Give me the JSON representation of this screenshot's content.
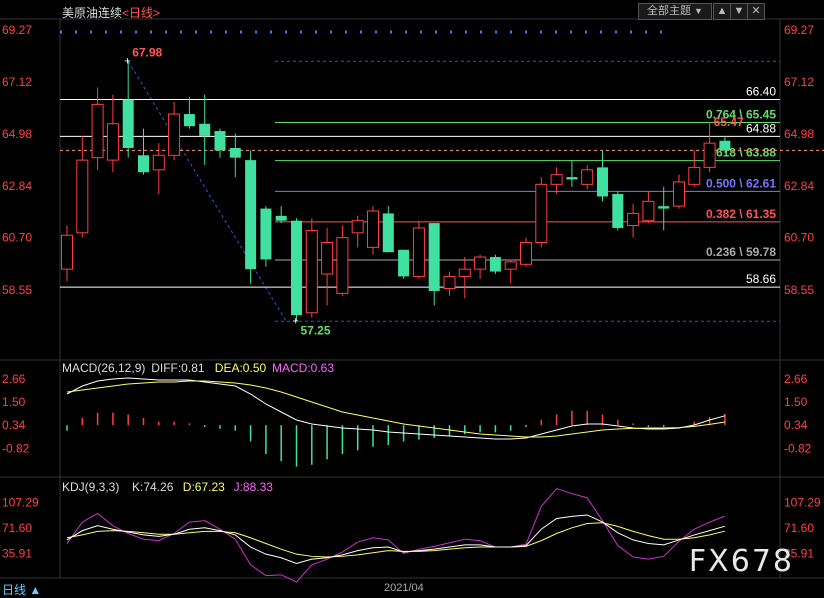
{
  "header": {
    "symbol": "美原油连续",
    "period": "<日线>",
    "theme_label": "全部主题",
    "theme_arrow": "▼",
    "nav_up": "▲",
    "nav_down": "▼",
    "nav_close": "✕"
  },
  "footer": {
    "period_label": "日线 ▲",
    "date_label": "2021/04"
  },
  "watermark": "FX678",
  "colors": {
    "up": "#ff4040",
    "down": "#40e0a0",
    "bg": "#000000",
    "grid": "#333333",
    "fib": "#ff5050",
    "macd_dif": "#ffffff",
    "macd_dea": "#ffff66",
    "kdj_j": "#cc33cc"
  },
  "chart_data": [
    {
      "type": "candlestick",
      "title": "美原油连续",
      "y_ticks": [
        69.27,
        67.12,
        64.98,
        62.84,
        60.7,
        58.55
      ],
      "ylim": [
        56.6,
        69.6
      ],
      "candles": [
        {
          "o": 59.4,
          "h": 61.2,
          "l": 58.9,
          "c": 60.8
        },
        {
          "o": 60.9,
          "h": 64.9,
          "l": 60.7,
          "c": 63.9
        },
        {
          "o": 64.0,
          "h": 66.9,
          "l": 63.5,
          "c": 66.2
        },
        {
          "o": 63.9,
          "h": 66.6,
          "l": 63.4,
          "c": 65.4
        },
        {
          "o": 66.4,
          "h": 67.98,
          "l": 64.0,
          "c": 64.4
        },
        {
          "o": 64.1,
          "h": 65.2,
          "l": 63.3,
          "c": 63.4
        },
        {
          "o": 63.5,
          "h": 64.6,
          "l": 62.5,
          "c": 64.1
        },
        {
          "o": 64.1,
          "h": 66.3,
          "l": 63.9,
          "c": 65.8
        },
        {
          "o": 65.8,
          "h": 66.5,
          "l": 65.2,
          "c": 65.3
        },
        {
          "o": 65.4,
          "h": 66.6,
          "l": 63.7,
          "c": 64.9
        },
        {
          "o": 65.1,
          "h": 65.2,
          "l": 64.0,
          "c": 64.3
        },
        {
          "o": 64.4,
          "h": 65.0,
          "l": 63.2,
          "c": 64.0
        },
        {
          "o": 63.9,
          "h": 64.3,
          "l": 58.8,
          "c": 59.4
        },
        {
          "o": 61.9,
          "h": 62.0,
          "l": 59.5,
          "c": 59.8
        },
        {
          "o": 61.6,
          "h": 62.0,
          "l": 61.3,
          "c": 61.4
        },
        {
          "o": 61.4,
          "h": 61.5,
          "l": 57.25,
          "c": 57.5
        },
        {
          "o": 57.6,
          "h": 61.5,
          "l": 57.4,
          "c": 61.0
        },
        {
          "o": 59.2,
          "h": 61.1,
          "l": 57.9,
          "c": 60.5
        },
        {
          "o": 58.4,
          "h": 61.2,
          "l": 58.3,
          "c": 60.7
        },
        {
          "o": 60.9,
          "h": 61.6,
          "l": 60.3,
          "c": 61.4
        },
        {
          "o": 60.3,
          "h": 62.0,
          "l": 60.0,
          "c": 61.8
        },
        {
          "o": 61.7,
          "h": 62.0,
          "l": 61.6,
          "c": 60.1
        },
        {
          "o": 60.2,
          "h": 60.2,
          "l": 59.0,
          "c": 59.1
        },
        {
          "o": 59.1,
          "h": 61.4,
          "l": 59.0,
          "c": 61.1
        },
        {
          "o": 61.3,
          "h": 61.3,
          "l": 57.9,
          "c": 58.5
        },
        {
          "o": 58.6,
          "h": 59.3,
          "l": 58.3,
          "c": 59.1
        },
        {
          "o": 59.1,
          "h": 59.9,
          "l": 58.2,
          "c": 59.4
        },
        {
          "o": 59.4,
          "h": 60.0,
          "l": 59.0,
          "c": 59.9
        },
        {
          "o": 59.9,
          "h": 60.0,
          "l": 59.2,
          "c": 59.3
        },
        {
          "o": 59.4,
          "h": 59.8,
          "l": 58.8,
          "c": 59.7
        },
        {
          "o": 59.6,
          "h": 60.7,
          "l": 59.5,
          "c": 60.5
        },
        {
          "o": 60.5,
          "h": 63.2,
          "l": 60.3,
          "c": 62.9
        },
        {
          "o": 62.9,
          "h": 63.6,
          "l": 62.5,
          "c": 63.3
        },
        {
          "o": 63.2,
          "h": 63.9,
          "l": 62.8,
          "c": 63.1
        },
        {
          "o": 62.9,
          "h": 63.7,
          "l": 62.7,
          "c": 63.5
        },
        {
          "o": 63.6,
          "h": 64.3,
          "l": 62.2,
          "c": 62.4
        },
        {
          "o": 62.5,
          "h": 62.6,
          "l": 61.0,
          "c": 61.1
        },
        {
          "o": 61.2,
          "h": 62.1,
          "l": 60.7,
          "c": 61.7
        },
        {
          "o": 61.4,
          "h": 62.6,
          "l": 61.3,
          "c": 62.2
        },
        {
          "o": 62.0,
          "h": 62.8,
          "l": 61.0,
          "c": 61.9
        },
        {
          "o": 62.0,
          "h": 63.3,
          "l": 61.9,
          "c": 63.0
        },
        {
          "o": 62.9,
          "h": 64.3,
          "l": 62.8,
          "c": 63.6
        },
        {
          "o": 63.6,
          "h": 65.47,
          "l": 63.4,
          "c": 64.6
        },
        {
          "o": 64.7,
          "h": 64.9,
          "l": 64.2,
          "c": 64.3
        }
      ],
      "h_lines": [
        {
          "value": 66.4,
          "label": "66.40",
          "color": "#ffffff"
        },
        {
          "value": 64.88,
          "label": "64.88",
          "color": "#ffffff"
        },
        {
          "value": 58.66,
          "label": "58.66",
          "color": "#ffffff"
        }
      ],
      "fib_levels": [
        {
          "value": 65.45,
          "label": "0.764 \\ 65.45",
          "color": "#66dd66"
        },
        {
          "value": 63.88,
          "label": "0.618 \\ 63.88",
          "color": "#66dd66"
        },
        {
          "value": 62.61,
          "label": "0.500 \\ 62.61",
          "color": "#7777ff"
        },
        {
          "value": 61.35,
          "label": "0.382 \\ 61.35",
          "color": "#ff5555"
        },
        {
          "value": 59.78,
          "label": "0.236 \\ 59.78",
          "color": "#aaaaaa"
        }
      ],
      "fib_high": 67.98,
      "fib_low": 57.25,
      "current_price": 64.3,
      "annotations": [
        {
          "text": "67.98",
          "value": 67.98,
          "candle": 4,
          "color": "#ff5555",
          "pos": "above"
        },
        {
          "text": "57.25",
          "value": 57.25,
          "candle": 15,
          "color": "#66dd66",
          "pos": "below"
        },
        {
          "text": "65.47",
          "value": 65.47,
          "candle": 42,
          "color": "#ff5555",
          "pos": "left"
        }
      ]
    },
    {
      "type": "macd",
      "title": "MACD(26,12,9)",
      "legend": [
        {
          "text": "MACD(26,12,9)",
          "color": "#dddddd"
        },
        {
          "text": "DIFF:0.81",
          "color": "#dddddd"
        },
        {
          "text": "DEA:0.50",
          "color": "#ffff66"
        },
        {
          "text": "MACD:0.63",
          "color": "#ff66ff"
        }
      ],
      "y_ticks": [
        2.66,
        1.5,
        0.34,
        -0.82
      ],
      "ylim": [
        -1.8,
        3.0
      ],
      "dif": [
        1.9,
        2.3,
        2.55,
        2.65,
        2.7,
        2.65,
        2.6,
        2.6,
        2.6,
        2.5,
        2.4,
        2.3,
        1.9,
        1.4,
        1.0,
        0.6,
        0.4,
        0.3,
        0.2,
        0.15,
        0.1,
        0.0,
        -0.05,
        -0.1,
        -0.15,
        -0.2,
        -0.25,
        -0.3,
        -0.35,
        -0.35,
        -0.3,
        -0.1,
        0.1,
        0.3,
        0.4,
        0.4,
        0.3,
        0.2,
        0.15,
        0.15,
        0.2,
        0.35,
        0.6,
        0.81
      ],
      "dea": [
        2.0,
        2.1,
        2.2,
        2.3,
        2.4,
        2.45,
        2.5,
        2.5,
        2.55,
        2.55,
        2.5,
        2.45,
        2.35,
        2.2,
        2.0,
        1.75,
        1.5,
        1.25,
        1.0,
        0.85,
        0.7,
        0.55,
        0.4,
        0.3,
        0.2,
        0.1,
        0.0,
        -0.1,
        -0.15,
        -0.2,
        -0.25,
        -0.25,
        -0.2,
        -0.1,
        0.0,
        0.1,
        0.15,
        0.18,
        0.2,
        0.2,
        0.22,
        0.28,
        0.38,
        0.5
      ],
      "hist": [
        -0.3,
        0.4,
        0.7,
        0.7,
        0.6,
        0.4,
        0.2,
        0.2,
        0.1,
        -0.1,
        -0.2,
        -0.3,
        -0.9,
        -1.6,
        -2.0,
        -2.3,
        -2.2,
        -1.9,
        -1.6,
        -1.4,
        -1.2,
        -1.1,
        -0.9,
        -0.8,
        -0.7,
        -0.6,
        -0.5,
        -0.4,
        -0.4,
        -0.3,
        -0.1,
        0.3,
        0.6,
        0.8,
        0.8,
        0.6,
        0.3,
        0.1,
        -0.1,
        -0.1,
        0.0,
        0.2,
        0.45,
        0.63
      ]
    },
    {
      "type": "kdj",
      "title": "KDJ(9,3,3)",
      "legend": [
        {
          "text": "KDJ(9,3,3)",
          "color": "#dddddd"
        },
        {
          "text": "K:74.26",
          "color": "#dddddd"
        },
        {
          "text": "D:67.23",
          "color": "#ffff66"
        },
        {
          "text": "J:88.33",
          "color": "#ff66ff"
        }
      ],
      "y_ticks": [
        107.29,
        71.6,
        35.91
      ],
      "ylim": [
        10,
        125
      ],
      "k": [
        55,
        68,
        75,
        70,
        66,
        62,
        60,
        63,
        70,
        72,
        68,
        62,
        45,
        35,
        30,
        22,
        28,
        30,
        34,
        40,
        44,
        45,
        38,
        40,
        42,
        45,
        48,
        48,
        45,
        45,
        47,
        70,
        85,
        88,
        90,
        80,
        65,
        55,
        50,
        48,
        55,
        62,
        68,
        74.26
      ],
      "d": [
        58,
        62,
        67,
        68,
        67,
        65,
        63,
        63,
        65,
        67,
        67,
        65,
        58,
        50,
        42,
        35,
        32,
        31,
        32,
        34,
        37,
        40,
        39,
        39,
        40,
        42,
        44,
        45,
        45,
        45,
        46,
        54,
        64,
        72,
        78,
        79,
        74,
        67,
        61,
        56,
        56,
        58,
        62,
        67.23
      ],
      "j": [
        50,
        80,
        92,
        75,
        64,
        56,
        54,
        64,
        80,
        82,
        70,
        56,
        20,
        5,
        6,
        -4,
        20,
        28,
        38,
        52,
        58,
        55,
        36,
        42,
        46,
        51,
        56,
        54,
        45,
        45,
        49,
        102,
        127,
        120,
        114,
        82,
        47,
        31,
        28,
        32,
        53,
        70,
        80,
        88.33
      ]
    }
  ]
}
